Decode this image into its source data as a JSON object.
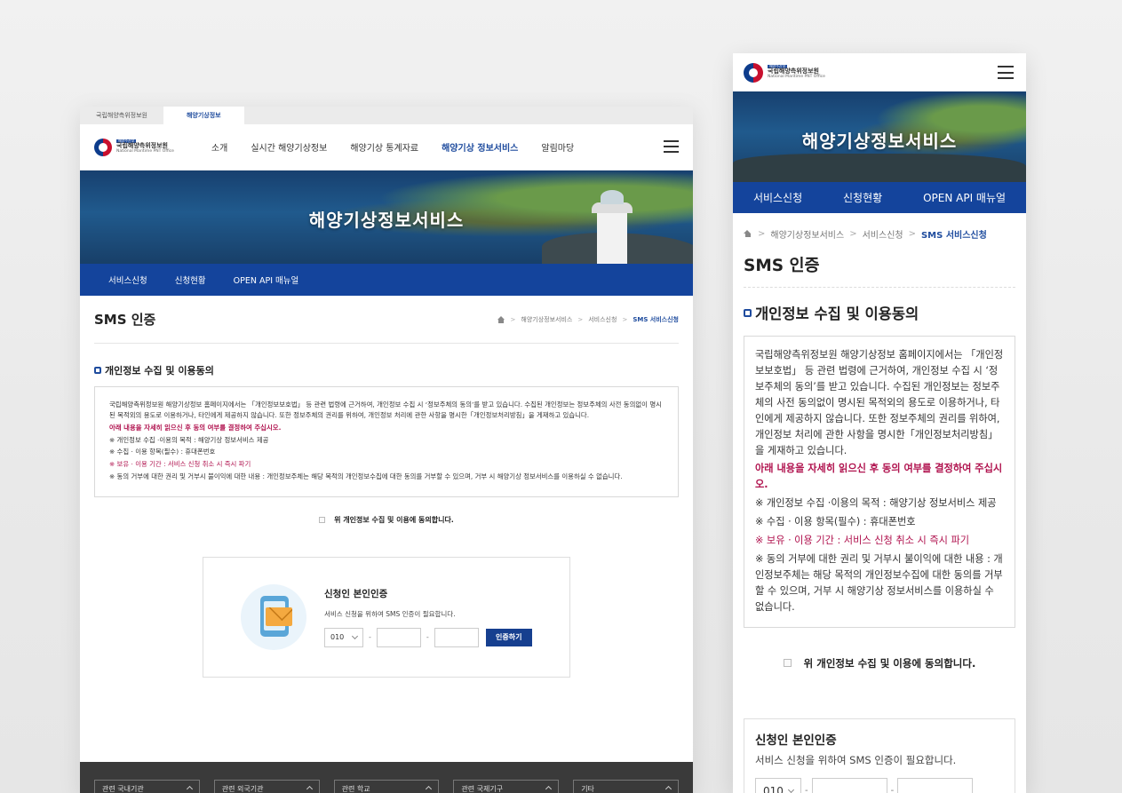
{
  "site": {
    "org_name": "국립해양측위정보원",
    "org_eng": "National Maritime PNT Office",
    "badge": "해양수산부",
    "hero_title": "해양기상정보서비스"
  },
  "desktop": {
    "site_tabs": [
      "국립해양측위정보원",
      "해양기상정보"
    ],
    "gnb": [
      "소개",
      "실시간 해양기상정보",
      "해양기상 통계자료",
      "해양기상 정보서비스",
      "알림마당"
    ],
    "footer_selects": [
      "관련 국내기관",
      "관련 외국기관",
      "관련 학교",
      "관련 국제기구",
      "기타"
    ]
  },
  "subnav": [
    "서비스신청",
    "신청현황",
    "OPEN API 매뉴얼"
  ],
  "page_title": "SMS 인증",
  "breadcrumb": [
    "해양기상정보서비스",
    "서비스신청",
    "SMS 서비스신청"
  ],
  "section_title": "개인정보 수집 및 이용동의",
  "agreement": {
    "intro": "국립해양측위정보원 해양기상정보 홈페이지에서는 「개인정보보호법」 등 관련 법령에 근거하여, 개인정보 수집 시 ‘정보주체의 동의’를 받고 있습니다. 수집된 개인정보는 정보주체의 사전 동의없이 명시된 목적외의 용도로 이용하거나, 타인에게 제공하지 않습니다. 또한 정보주체의 권리를 위하여, 개인정보 처리에 관한 사항을 명시한「개인정보처리방침」을 게재하고 있습니다.",
    "notice": "아래 내용을 자세히 읽으신 후 동의 여부를 결정하여 주십시오.",
    "purpose": "※ 개인정보 수집 ·이용의 목적 : 해양기상 정보서비스 제공",
    "items": "※ 수집 · 이용 항목(필수) : 휴대폰번호",
    "retention": "※ 보유 · 이용 기간 : 서비스 신청 취소 시 즉시 파기",
    "refusal": "※ 동의 거부에 대한 권리 및 거부시 불이익에 대한 내용 : 개인정보주체는 해당 목적의 개인정보수집에 대한 동의를 거부할 수 있으며, 거부 시 해양기상 정보서비스를 이용하실 수 없습니다."
  },
  "consent_label": "위 개인정보 수집 및 이용에 동의합니다.",
  "auth": {
    "title": "신청인 본인인증",
    "desc": "서비스 신청을 위하여 SMS 인증이 필요합니다.",
    "prefix": "010",
    "separator": "-",
    "button": "인증하기"
  },
  "colors": {
    "primary": "#14449c",
    "accent_red": "#b0124e",
    "footer_bg": "#3a3a3a"
  }
}
